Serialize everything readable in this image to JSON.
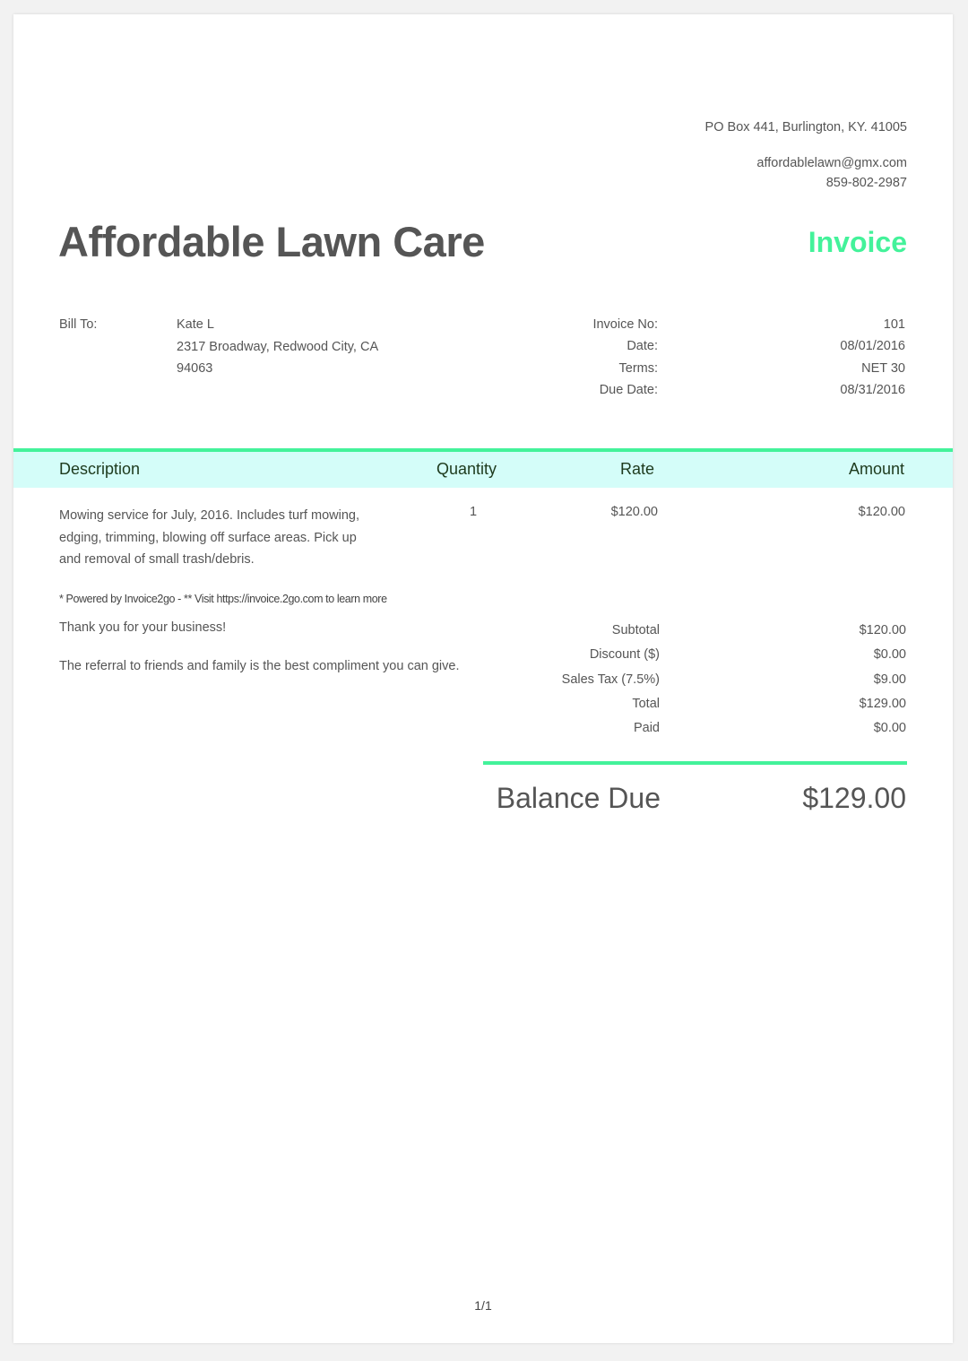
{
  "business": {
    "name": "Affordable Lawn Care",
    "address": "PO Box 441, Burlington, KY. 41005",
    "email": "affordablelawn@gmx.com",
    "phone": "859-802-2987"
  },
  "document_title": "Invoice",
  "bill_to": {
    "label": "Bill To:",
    "name": "Kate L",
    "address_line1": "2317 Broadway, Redwood City, CA",
    "address_line2": "94063"
  },
  "meta": [
    {
      "label": "Invoice No:",
      "value": "101"
    },
    {
      "label": "Date:",
      "value": "08/01/2016"
    },
    {
      "label": "Terms:",
      "value": "NET 30"
    },
    {
      "label": "Due Date:",
      "value": "08/31/2016"
    }
  ],
  "table": {
    "headers": {
      "description": "Description",
      "quantity": "Quantity",
      "rate": "Rate",
      "amount": "Amount"
    },
    "items": [
      {
        "description": "Mowing service for July, 2016. Includes turf mowing, edging, trimming, blowing off surface areas. Pick up and removal of small trash/debris.",
        "quantity": "1",
        "rate": "$120.00",
        "amount": "$120.00"
      }
    ]
  },
  "powered_by": "* Powered by Invoice2go - ** Visit https://invoice.2go.com to learn more",
  "notes": {
    "thanks": "Thank you for your business!",
    "referral": "The referral to friends and family is the best compliment you can give."
  },
  "totals": [
    {
      "label": "Subtotal",
      "value": "$120.00"
    },
    {
      "label": "Discount ($)",
      "value": "$0.00"
    },
    {
      "label": "Sales Tax (7.5%)",
      "value": "$9.00"
    },
    {
      "label": "Total",
      "value": "$129.00"
    },
    {
      "label": "Paid",
      "value": "$0.00"
    }
  ],
  "balance_due": {
    "label": "Balance Due",
    "value": "$129.00"
  },
  "page_number": "1/1",
  "colors": {
    "accent": "#43f29a",
    "header_bg": "#d4fdf9",
    "text": "#555555"
  }
}
